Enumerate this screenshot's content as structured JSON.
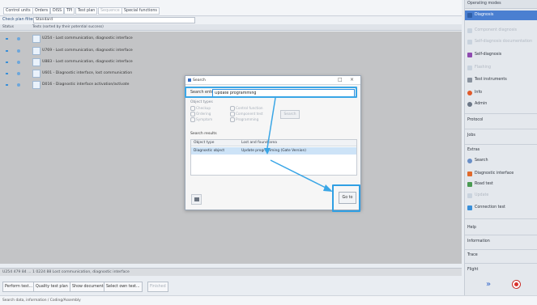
{
  "tabs": [
    {
      "label": "Control units",
      "disabled": false
    },
    {
      "label": "Orders",
      "disabled": false
    },
    {
      "label": "DISS",
      "disabled": false
    },
    {
      "label": "TPI",
      "disabled": false
    },
    {
      "label": "Test plan",
      "disabled": false
    },
    {
      "label": "Sequence",
      "disabled": true
    },
    {
      "label": "Special functions",
      "disabled": false
    }
  ],
  "filter": {
    "label": "Check plan filters",
    "value": "Standard"
  },
  "table": {
    "header": {
      "status": "Status",
      "texts": "Texts (sorted by their potential success)"
    },
    "rows": [
      {
        "text": "U254 - Lost communication, diagnostic interface"
      },
      {
        "text": "U769 - Lost communication, diagnostic interface"
      },
      {
        "text": "U883 - Lost communication, diagnostic interface"
      },
      {
        "text": "U601 - Diagnostic interface, lost communication"
      },
      {
        "text": "D016 - Diagnostic interface activation/activate"
      }
    ]
  },
  "status_line": "U254 479 84 ... 1 0224 88 Lost communication, diagnostic interface",
  "buttons": {
    "perform": "Perform test...",
    "quality": "Quality test plan",
    "show_docs": "Show documents",
    "select_own": "Select own test...",
    "finished": "Finished"
  },
  "bottom_status": "Search data, information / Coding/Assembly",
  "right_panel": {
    "header": "Operating modes",
    "items": [
      {
        "label": "Diagnosis",
        "state": "active",
        "color": "#2f5fa8"
      },
      {
        "label": "Component diagnosis",
        "state": "disabled",
        "color": "#c9d3de"
      },
      {
        "label": "Self-diagnosis documentation",
        "state": "disabled",
        "color": "#c9d3de"
      },
      {
        "label": "Self-diagnosis",
        "state": "normal",
        "color": "#8f4bb0"
      },
      {
        "label": "Flashing",
        "state": "disabled",
        "color": "#c9d3de"
      },
      {
        "label": "Test instruments",
        "state": "normal",
        "color": "#8a939f"
      },
      {
        "label": "Info",
        "state": "normal",
        "color": "#e05a2b"
      },
      {
        "label": "Admin",
        "state": "normal",
        "color": "#6b7686"
      }
    ],
    "sections": {
      "protocol": "Protocol",
      "jobs": "Jobs",
      "extras": "Extras",
      "help": "Help",
      "information": "Information",
      "trace": "Trace",
      "flight": "Flight"
    },
    "extras": [
      {
        "label": "Search",
        "state": "normal",
        "color": "#6a8fc7"
      },
      {
        "label": "Diagnostic interface",
        "state": "normal",
        "color": "#e06a2c"
      },
      {
        "label": "Road test",
        "state": "normal",
        "color": "#4a9a52"
      },
      {
        "label": "Update",
        "state": "disabled",
        "color": "#c9d3de"
      },
      {
        "label": "Connection test",
        "state": "normal",
        "color": "#3a8fd8"
      }
    ]
  },
  "dialog": {
    "title": "Search",
    "search_label": "Search entry",
    "search_value": "Update programming",
    "object_types_label": "Object types",
    "options": [
      "Checkup",
      "Ordering",
      "Symptom",
      "Control function",
      "Component test",
      "Programming"
    ],
    "search_button": "Search",
    "results_label": "Search results",
    "col_type": "Object type",
    "col_name": "Lost and found area",
    "results": [
      {
        "type": "Diagnostic object",
        "name": "Update programming (Gate Version)"
      }
    ],
    "goto": "Go to"
  },
  "colors": {
    "accent": "#3aa6e6",
    "active": "#4a7fd1",
    "stop": "#d9322d"
  }
}
